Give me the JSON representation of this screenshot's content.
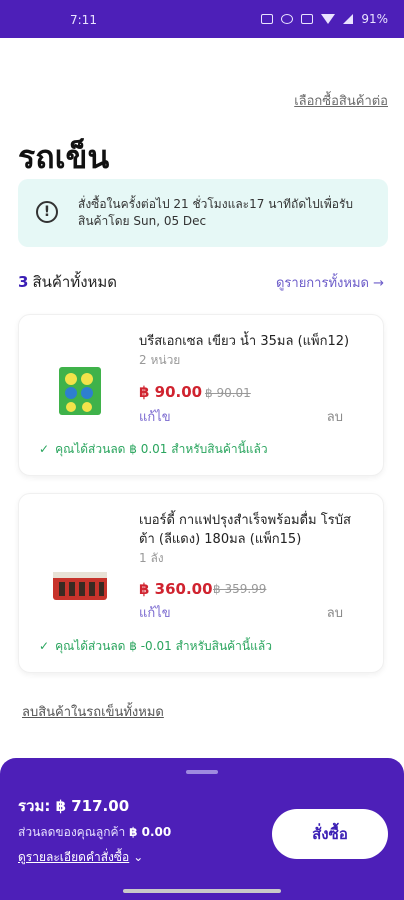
{
  "status_bar": {
    "time": "7:11",
    "battery": "91%"
  },
  "header": {
    "continue_shopping": "เลือกซื้อสินค้าต่อ",
    "title": "รถเข็น"
  },
  "notice": {
    "text": "สั่งซื้อในครั้งต่อไป 21 ชั่วโมงและ17 นาทีถัดไปเพื่อรับสินค้าโดย Sun, 05 Dec"
  },
  "summary": {
    "count": "3",
    "count_label": "สินค้าทั้งหมด",
    "view_all": "ดูรายการทั้งหมด →"
  },
  "items": [
    {
      "name": "บรีสเอกเซล เขียว น้ำ 35มล (แพ็ก12)",
      "quantity": "2 หน่วย",
      "price": "฿ 90.00",
      "old_price": "฿ 90.01",
      "edit": "แก้ไข",
      "delete": "ลบ",
      "discount": "คุณได้ส่วนลด ฿ 0.01 สำหรับสินค้านี้แล้ว",
      "thumb_color": "#3fb24a"
    },
    {
      "name": "เบอร์ดี้ กาแฟปรุงสำเร็จพร้อมดื่ม โรบัสต้า (ลีแดง) 180มล (แพ็ก15)",
      "quantity": "1 ลัง",
      "price": "฿ 360.00",
      "old_price": "฿ 359.99",
      "edit": "แก้ไข",
      "delete": "ลบ",
      "discount": "คุณได้ส่วนลด ฿ -0.01 สำหรับสินค้านี้แล้ว",
      "thumb_color": "#c7332b"
    }
  ],
  "clear_cart": "ลบสินค้าในรถเข็นทั้งหมด",
  "checkout": {
    "total": "รวม: ฿ 717.00",
    "savings_label": "ส่วนลดของคุณลูกค้า",
    "savings_value": "฿ 0.00",
    "details_link": "ดูรายละเอียดคำสั่งซื้อ",
    "order_button": "สั่งซื้อ"
  },
  "colors": {
    "brand": "#4d1fb8",
    "price": "#d0232f",
    "discount": "#2aa55e",
    "notice_bg": "#e6f8f6"
  }
}
